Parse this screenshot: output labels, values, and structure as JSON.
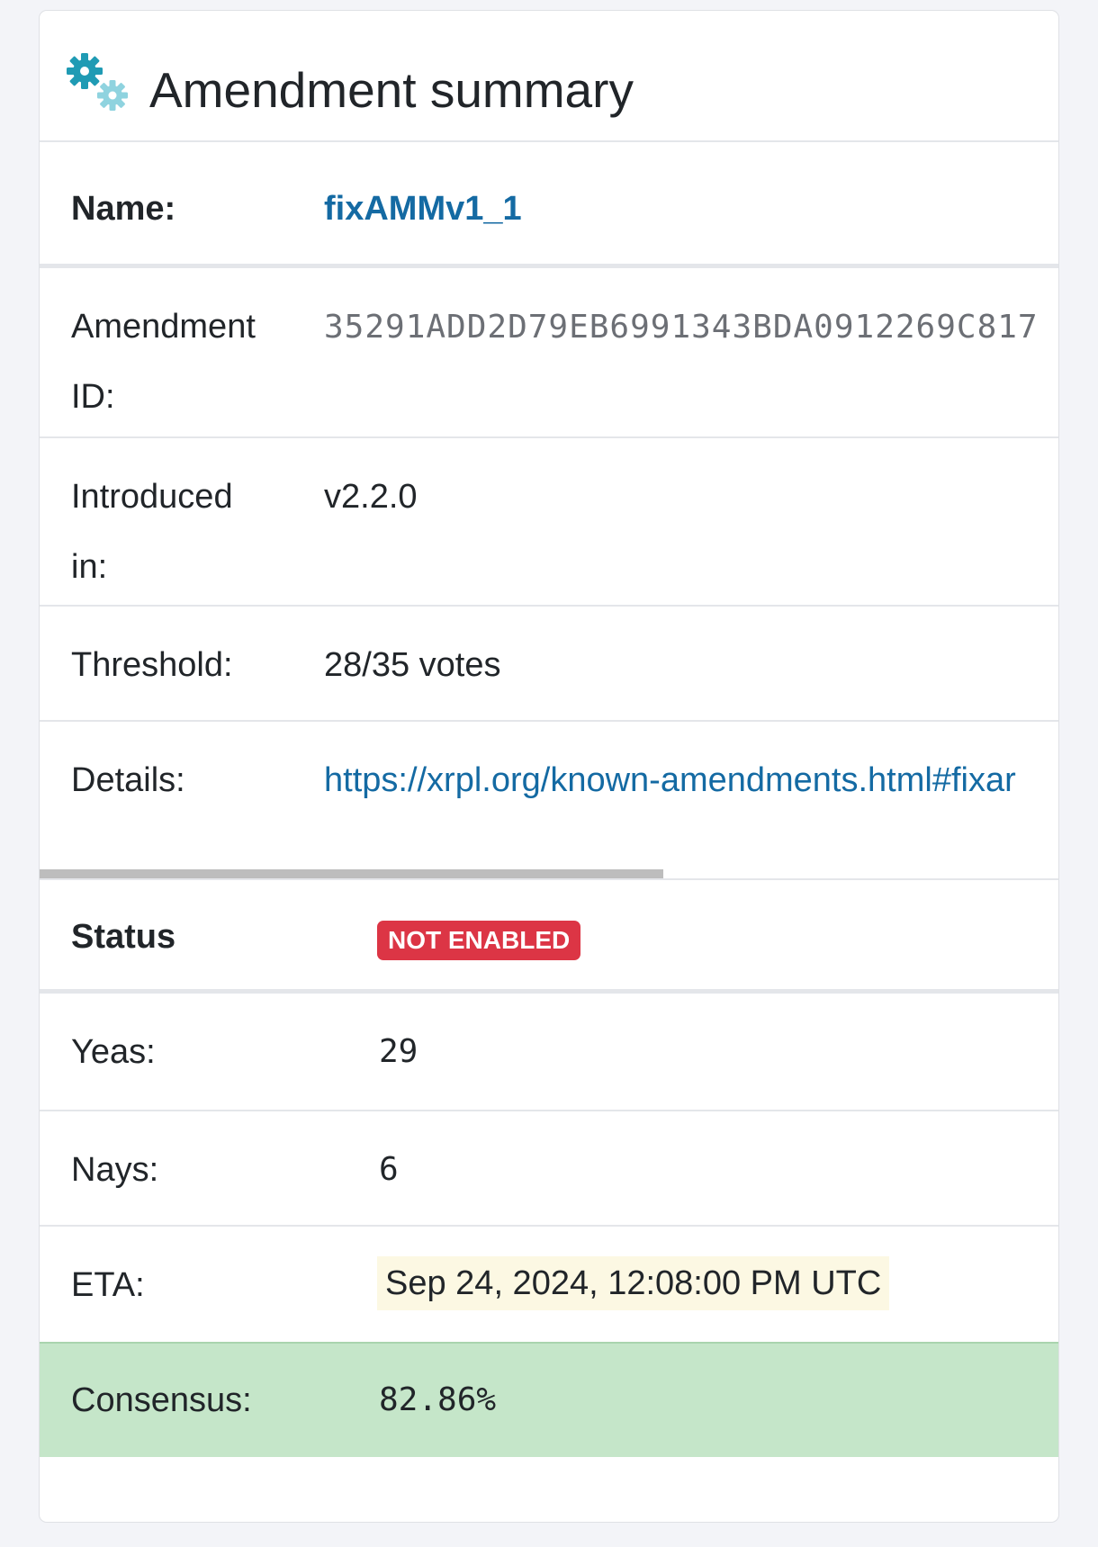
{
  "card": {
    "title": "Amendment summary",
    "header_icon": "gears-icon"
  },
  "fields": {
    "name_label": "Name:",
    "name_value": "fixAMMv1_1",
    "amendment_id_label_line1": "Amendment",
    "amendment_id_label_line2": "ID:",
    "amendment_id_value": "35291ADD2D79EB6991343BDA0912269C817",
    "introduced_label_line1": "Introduced",
    "introduced_label_line2": "in:",
    "introduced_value": "v2.2.0",
    "threshold_label": "Threshold:",
    "threshold_value": "28/35 votes",
    "details_label": "Details:",
    "details_value": "https://xrpl.org/known-amendments.html#fixar"
  },
  "status": {
    "label": "Status",
    "badge": "NOT ENABLED",
    "badge_color": "#dc3545",
    "yeas_label": "Yeas:",
    "yeas_value": "29",
    "nays_label": "Nays:",
    "nays_value": "6",
    "eta_label": "ETA:",
    "eta_value": "Sep 24, 2024, 12:08:00 PM UTC",
    "consensus_label": "Consensus:",
    "consensus_value": "82.86%",
    "consensus_color": "#c5e6c9"
  },
  "colors": {
    "link": "#146aa3",
    "icon_primary": "#1f9bb4",
    "icon_secondary": "#8fd3df"
  }
}
